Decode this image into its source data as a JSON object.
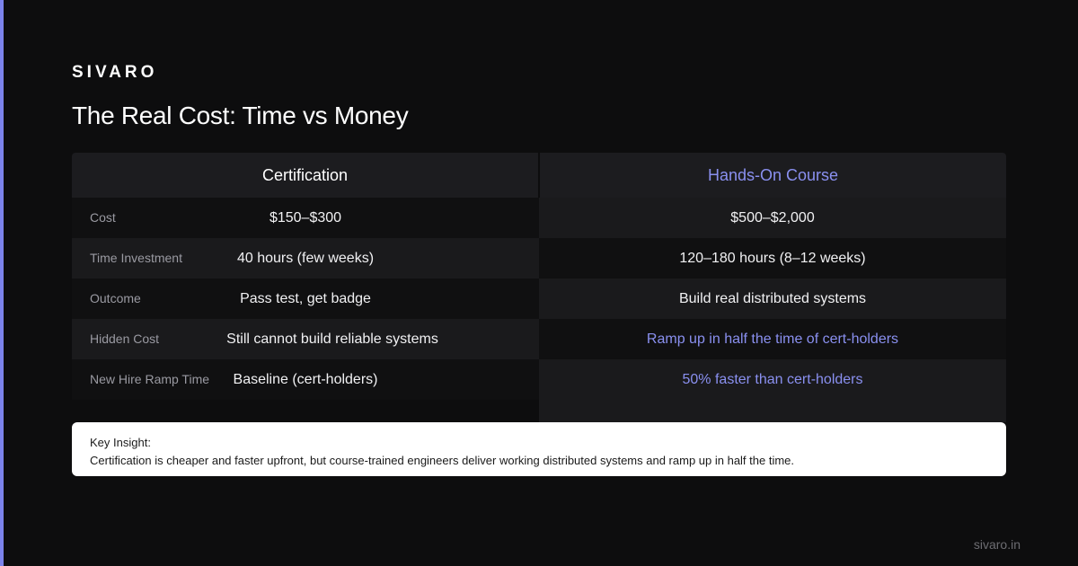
{
  "brand": "SIVARO",
  "title": "The Real Cost: Time vs Money",
  "columns": {
    "left": "Certification",
    "right": "Hands-On Course"
  },
  "rows": [
    {
      "label": "Cost",
      "certification": "$150–$300",
      "course": "$500–$2,000"
    },
    {
      "label": "Time Investment",
      "certification": "40 hours (few weeks)",
      "course": "120–180 hours (8–12 weeks)"
    },
    {
      "label": "Outcome",
      "certification": "Pass test, get badge",
      "course": "Build real distributed systems"
    },
    {
      "label": "Hidden Cost",
      "certification": "Still cannot build reliable systems",
      "course": "Ramp up in half the time of cert-holders"
    },
    {
      "label": "New Hire Ramp Time",
      "certification": "Baseline (cert-holders)",
      "course": "50% faster than cert-holders"
    }
  ],
  "insight": {
    "label": "Key Insight:",
    "text": "Certification is cheaper and faster upfront, but course-trained engineers deliver working distributed systems and ramp up in half the time."
  },
  "footer_url": "sivaro.in",
  "colors": {
    "accent": "#7b83eb",
    "background": "#0d0d0e"
  }
}
